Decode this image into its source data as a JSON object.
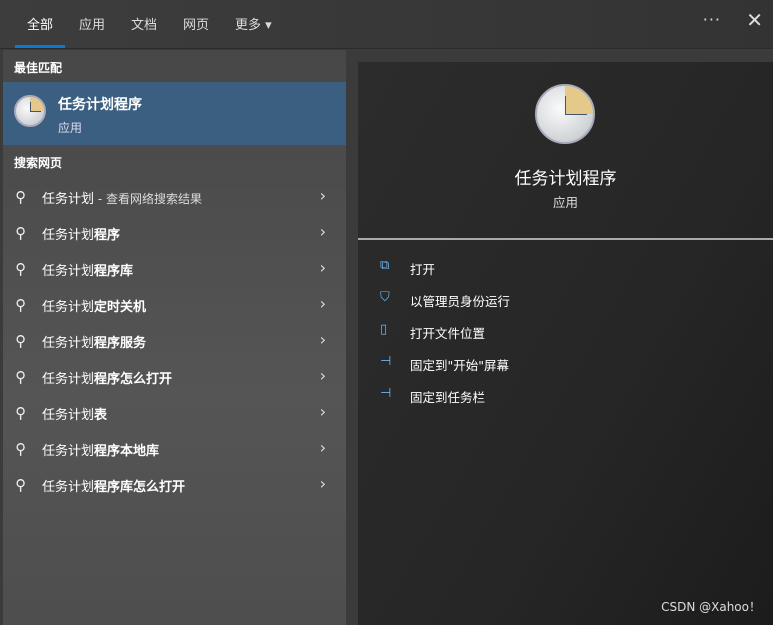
{
  "tabs": [
    "全部",
    "应用",
    "文档",
    "网页",
    "更多 ▾"
  ],
  "more_label": "···",
  "close_label": "✕",
  "best_match": {
    "heading": "最佳匹配",
    "title": "任务计划程序",
    "subtitle": "应用"
  },
  "web": {
    "heading": "搜索网页",
    "items": [
      {
        "q": "任务计划",
        "rest": " - 查看网络搜索结果",
        "sub": true
      },
      {
        "q": "任务计划",
        "rest": "程序"
      },
      {
        "q": "任务计划",
        "rest": "程序库"
      },
      {
        "q": "任务计划",
        "rest": "定时关机"
      },
      {
        "q": "任务计划",
        "rest": "程序服务"
      },
      {
        "q": "任务计划",
        "rest": "程序怎么打开"
      },
      {
        "q": "任务计划",
        "rest": "表"
      },
      {
        "q": "任务计划",
        "rest": "程序本地库"
      },
      {
        "q": "任务计划",
        "rest": "程序库怎么打开"
      }
    ]
  },
  "detail": {
    "title": "任务计划程序",
    "subtitle": "应用",
    "actions": [
      {
        "icon": "open-icon",
        "glyph": "⧉",
        "label": "打开"
      },
      {
        "icon": "admin-shield-icon",
        "glyph": "⛉",
        "label": "以管理员身份运行"
      },
      {
        "icon": "folder-icon",
        "glyph": "▯",
        "label": "打开文件位置"
      },
      {
        "icon": "pin-icon",
        "glyph": "⊣",
        "label": "固定到\"开始\"屏幕"
      },
      {
        "icon": "pin-icon",
        "glyph": "⊣",
        "label": "固定到任务栏"
      }
    ]
  },
  "watermark": "CSDN @Xahoo！"
}
